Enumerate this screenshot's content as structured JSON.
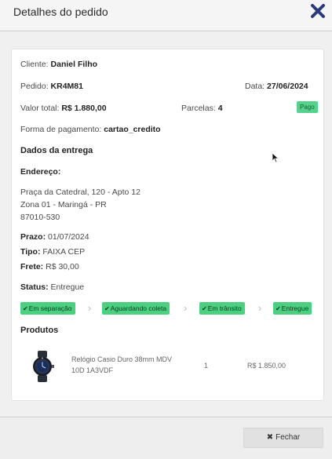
{
  "header": {
    "title": "Detalhes do pedido"
  },
  "order": {
    "cliente_label": "Cliente:",
    "cliente": "Daniel Filho",
    "pedido_label": "Pedido:",
    "pedido": "KR4M81",
    "data_label": "Data:",
    "data": "27/06/2024",
    "valor_label": "Valor total:",
    "valor": "R$ 1.880,00",
    "parcelas_label": "Parcelas:",
    "parcelas": "4",
    "status_pagamento": "Pago",
    "forma_label": "Forma de pagamento:",
    "forma": "cartao_credito"
  },
  "delivery": {
    "heading": "Dados da entrega",
    "endereco_label": "Endereço:",
    "address_line1": "Praça da Catedral, 120 - Apto 12",
    "address_line2": "Zona 01 - Maringá - PR",
    "address_line3": "87010-530",
    "prazo_label": "Prazo:",
    "prazo": "01/07/2024",
    "tipo_label": "Tipo:",
    "tipo": "FAIXA CEP",
    "frete_label": "Frete:",
    "frete": "R$ 30,00",
    "status_label": "Status:",
    "status": "Entregue",
    "steps": [
      "Em separação",
      "Aguardando coleta",
      "Em trânsito",
      "Entregue"
    ]
  },
  "products": {
    "heading": "Produtos",
    "items": [
      {
        "name_line1": "Relógio Casio Duro 38mm MDV",
        "name_line2": "10D 1A3VDF",
        "qty": "1",
        "price": "R$ 1.850,00"
      }
    ]
  },
  "footer": {
    "close_label": "Fechar"
  },
  "colors": {
    "step_bg": "#4ccf7f",
    "badge_bg": "#55d38c",
    "close_icon": "#2b3a7a"
  },
  "icons": {
    "close": "close-icon",
    "check": "check-icon",
    "chevron": "chevron-right-icon",
    "close_small": "times-icon"
  }
}
